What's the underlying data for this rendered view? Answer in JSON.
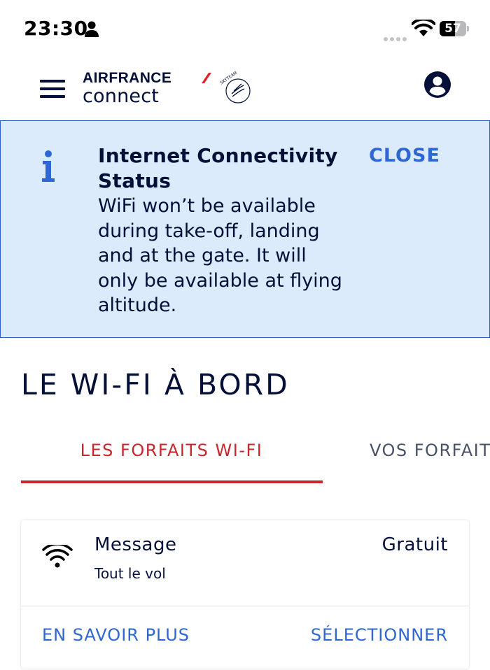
{
  "status_bar": {
    "time": "23:30",
    "battery": "57",
    "battery_level": 0.57,
    "icons": [
      "person-icon",
      "signal-icon",
      "wifi-icon",
      "battery-icon"
    ]
  },
  "header": {
    "brand_top": "AIRFRANCE",
    "brand_bottom": "connect",
    "skyteam_text": "SKYTEAM",
    "icons": [
      "menu-icon",
      "skyteam-logo",
      "account-icon"
    ]
  },
  "banner": {
    "title": "Internet Connectivity Status",
    "body": "WiFi won’t be available during take-off, landing and at the gate. It will only be available at flying altitude.",
    "close_label": "CLOSE",
    "icon": "info-icon",
    "background": "#dbebfc",
    "border": "#2d5ec9"
  },
  "page": {
    "title": "LE WI-FI À BORD"
  },
  "tabs": [
    {
      "label": "LES FORFAITS WI-FI",
      "active": true
    },
    {
      "label": "VOS FORFAITS",
      "active": false
    }
  ],
  "offer": {
    "icon": "wifi-icon",
    "name": "Message",
    "duration": "Tout le vol",
    "price": "Gratuit",
    "more_label": "EN SAVOIR PLUS",
    "select_label": "SÉLECTIONNER"
  },
  "colors": {
    "navy": "#051039",
    "accent_red": "#c8272d",
    "link_blue": "#2e66d4"
  }
}
